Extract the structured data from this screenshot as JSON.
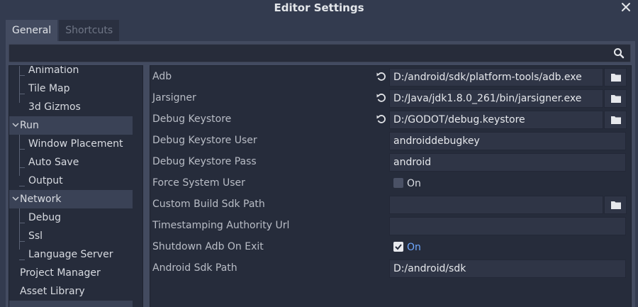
{
  "window": {
    "title": "Editor Settings"
  },
  "tabs": [
    {
      "label": "General",
      "active": true
    },
    {
      "label": "Shortcuts",
      "active": false
    }
  ],
  "search": {
    "placeholder": ""
  },
  "tree": {
    "items": [
      {
        "label": "Animation",
        "level": 1
      },
      {
        "label": "Tile Map",
        "level": 1
      },
      {
        "label": "3d Gizmos",
        "level": 1
      },
      {
        "label": "Run",
        "level": 0,
        "expanded": true
      },
      {
        "label": "Window Placement",
        "level": 1
      },
      {
        "label": "Auto Save",
        "level": 1
      },
      {
        "label": "Output",
        "level": 1
      },
      {
        "label": "Network",
        "level": 0,
        "expanded": true
      },
      {
        "label": "Debug",
        "level": 1
      },
      {
        "label": "Ssl",
        "level": 1
      },
      {
        "label": "Language Server",
        "level": 1
      },
      {
        "label": "Project Manager",
        "level": 0
      },
      {
        "label": "Asset Library",
        "level": 0
      }
    ]
  },
  "properties": [
    {
      "label": "Adb",
      "value": "D:/android/sdk/platform-tools/adb.exe"
    },
    {
      "label": "Jarsigner",
      "value": "D:/Java/jdk1.8.0_261/bin/jarsigner.exe"
    },
    {
      "label": "Debug Keystore",
      "value": "D:/GODOT/debug.keystore"
    },
    {
      "label": "Debug Keystore User",
      "value": "androiddebugkey"
    },
    {
      "label": "Debug Keystore Pass",
      "value": "android"
    },
    {
      "label": "Force System User",
      "check_label": "On",
      "checked": false
    },
    {
      "label": "Custom Build Sdk Path",
      "value": ""
    },
    {
      "label": "Timestamping Authority Url",
      "value": ""
    },
    {
      "label": "Shutdown Adb On Exit",
      "check_label": "On",
      "checked": true
    },
    {
      "label": "Android Sdk Path",
      "value": "D:/android/sdk"
    }
  ],
  "colors": {
    "background": "#333b4f",
    "panel": "#434b60",
    "field": "#2f3546",
    "accent": "#6fa8ff"
  }
}
